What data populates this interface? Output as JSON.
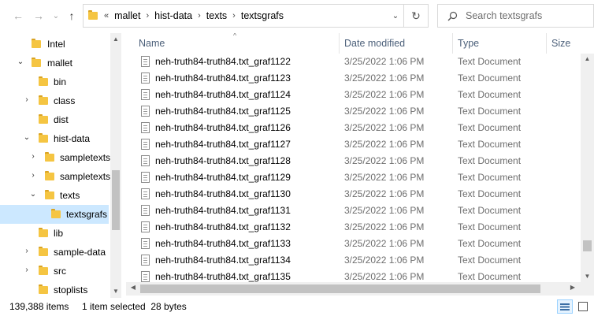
{
  "toolbar": {
    "back_icon": "arrow-left-icon",
    "forward_icon": "arrow-right-icon",
    "recent_icon": "chevron-down-icon",
    "up_icon": "arrow-up-icon",
    "address": {
      "overflow": "«",
      "crumbs": [
        "mallet",
        "hist-data",
        "texts",
        "textsgrafs"
      ],
      "separator": "›"
    },
    "search": {
      "placeholder": "Search textsgrafs"
    }
  },
  "nav": {
    "items": [
      {
        "label": "Intel",
        "chevron": ""
      },
      {
        "label": "mallet",
        "chevron": "⌄"
      },
      {
        "label": "bin",
        "chevron": ""
      },
      {
        "label": "class",
        "chevron": "›"
      },
      {
        "label": "dist",
        "chevron": ""
      },
      {
        "label": "hist-data",
        "chevron": "⌄"
      },
      {
        "label": "sampletexts",
        "chevron": "›"
      },
      {
        "label": "sampletexts",
        "chevron": "›"
      },
      {
        "label": "texts",
        "chevron": "⌄"
      },
      {
        "label": "textsgrafs",
        "chevron": ""
      },
      {
        "label": "lib",
        "chevron": ""
      },
      {
        "label": "sample-data",
        "chevron": "›"
      },
      {
        "label": "src",
        "chevron": "›"
      },
      {
        "label": "stoplists",
        "chevron": ""
      }
    ]
  },
  "columns": {
    "name": "Name",
    "date": "Date modified",
    "type": "Type",
    "size": "Size"
  },
  "files": [
    {
      "name": "neh-truth84-truth84.txt_graf1122",
      "date": "3/25/2022 1:06 PM",
      "type": "Text Document"
    },
    {
      "name": "neh-truth84-truth84.txt_graf1123",
      "date": "3/25/2022 1:06 PM",
      "type": "Text Document"
    },
    {
      "name": "neh-truth84-truth84.txt_graf1124",
      "date": "3/25/2022 1:06 PM",
      "type": "Text Document"
    },
    {
      "name": "neh-truth84-truth84.txt_graf1125",
      "date": "3/25/2022 1:06 PM",
      "type": "Text Document"
    },
    {
      "name": "neh-truth84-truth84.txt_graf1126",
      "date": "3/25/2022 1:06 PM",
      "type": "Text Document"
    },
    {
      "name": "neh-truth84-truth84.txt_graf1127",
      "date": "3/25/2022 1:06 PM",
      "type": "Text Document"
    },
    {
      "name": "neh-truth84-truth84.txt_graf1128",
      "date": "3/25/2022 1:06 PM",
      "type": "Text Document"
    },
    {
      "name": "neh-truth84-truth84.txt_graf1129",
      "date": "3/25/2022 1:06 PM",
      "type": "Text Document"
    },
    {
      "name": "neh-truth84-truth84.txt_graf1130",
      "date": "3/25/2022 1:06 PM",
      "type": "Text Document"
    },
    {
      "name": "neh-truth84-truth84.txt_graf1131",
      "date": "3/25/2022 1:06 PM",
      "type": "Text Document"
    },
    {
      "name": "neh-truth84-truth84.txt_graf1132",
      "date": "3/25/2022 1:06 PM",
      "type": "Text Document"
    },
    {
      "name": "neh-truth84-truth84.txt_graf1133",
      "date": "3/25/2022 1:06 PM",
      "type": "Text Document"
    },
    {
      "name": "neh-truth84-truth84.txt_graf1134",
      "date": "3/25/2022 1:06 PM",
      "type": "Text Document"
    },
    {
      "name": "neh-truth84-truth84.txt_graf1135",
      "date": "3/25/2022 1:06 PM",
      "type": "Text Document"
    }
  ],
  "status": {
    "item_count": "139,388 items",
    "selection": "1 item selected  28 bytes"
  },
  "colors": {
    "selected_bg": "#cce8ff",
    "folder": "#f5c542",
    "header_text": "#4c607a",
    "muted_text": "#6d6d6d"
  }
}
